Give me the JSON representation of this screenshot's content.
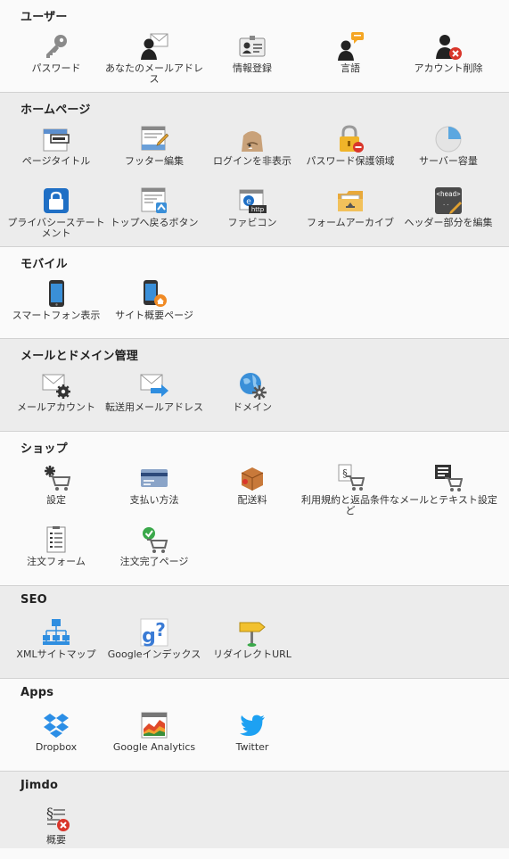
{
  "sections": [
    {
      "title": "ユーザー",
      "items": [
        {
          "label": "パスワード",
          "icon": "key-icon"
        },
        {
          "label": "あなたのメールアドレス",
          "icon": "user-mail-icon"
        },
        {
          "label": "情報登録",
          "icon": "id-card-icon"
        },
        {
          "label": "言語",
          "icon": "user-speech-icon"
        },
        {
          "label": "アカウント削除",
          "icon": "user-delete-icon"
        }
      ]
    },
    {
      "title": "ホームページ",
      "items": [
        {
          "label": "ページタイトル",
          "icon": "page-title-icon"
        },
        {
          "label": "フッター編集",
          "icon": "footer-edit-icon"
        },
        {
          "label": "ログインを非表示",
          "icon": "hide-login-icon"
        },
        {
          "label": "パスワード保護領域",
          "icon": "lock-protect-icon"
        },
        {
          "label": "サーバー容量",
          "icon": "pie-storage-icon"
        },
        {
          "label": "プライバシーステートメント",
          "icon": "privacy-lock-icon"
        },
        {
          "label": "トップへ戻るボタン",
          "icon": "back-to-top-icon"
        },
        {
          "label": "ファビコン",
          "icon": "favicon-icon"
        },
        {
          "label": "フォームアーカイブ",
          "icon": "folder-archive-icon"
        },
        {
          "label": "ヘッダー部分を編集",
          "icon": "head-code-icon"
        }
      ]
    },
    {
      "title": "モバイル",
      "items": [
        {
          "label": "スマートフォン表示",
          "icon": "smartphone-icon"
        },
        {
          "label": "サイト概要ページ",
          "icon": "phone-home-icon"
        }
      ]
    },
    {
      "title": "メールとドメイン管理",
      "items": [
        {
          "label": "メールアカウント",
          "icon": "mail-gear-icon"
        },
        {
          "label": "転送用メールアドレス",
          "icon": "mail-forward-icon"
        },
        {
          "label": "ドメイン",
          "icon": "globe-gear-icon"
        }
      ]
    },
    {
      "title": "ショップ",
      "items": [
        {
          "label": "設定",
          "icon": "cart-gear-icon"
        },
        {
          "label": "支払い方法",
          "icon": "credit-card-icon"
        },
        {
          "label": "配送料",
          "icon": "shipping-box-icon"
        },
        {
          "label": "利用規約と返品条件など",
          "icon": "cart-terms-icon"
        },
        {
          "label": "メールとテキスト設定",
          "icon": "cart-text-icon"
        },
        {
          "label": "注文フォーム",
          "icon": "order-form-icon"
        },
        {
          "label": "注文完了ページ",
          "icon": "cart-check-icon"
        }
      ]
    },
    {
      "title": "SEO",
      "items": [
        {
          "label": "XMLサイトマップ",
          "icon": "sitemap-icon"
        },
        {
          "label": "Googleインデックス",
          "icon": "google-index-icon"
        },
        {
          "label": "リダイレクトURL",
          "icon": "signpost-icon"
        }
      ]
    },
    {
      "title": "Apps",
      "items": [
        {
          "label": "Dropbox",
          "icon": "dropbox-icon"
        },
        {
          "label": "Google Analytics",
          "icon": "analytics-icon"
        },
        {
          "label": "Twitter",
          "icon": "twitter-bird-icon"
        }
      ]
    },
    {
      "title": "Jimdo",
      "items": [
        {
          "label": "概要",
          "icon": "terms-delete-icon"
        }
      ]
    }
  ],
  "colors": {
    "section_alt": "#ececec",
    "section_plain": "#fafafa",
    "border": "#d2d2d2",
    "twitter": "#1da1f2",
    "dropbox": "#2b8ee6"
  }
}
